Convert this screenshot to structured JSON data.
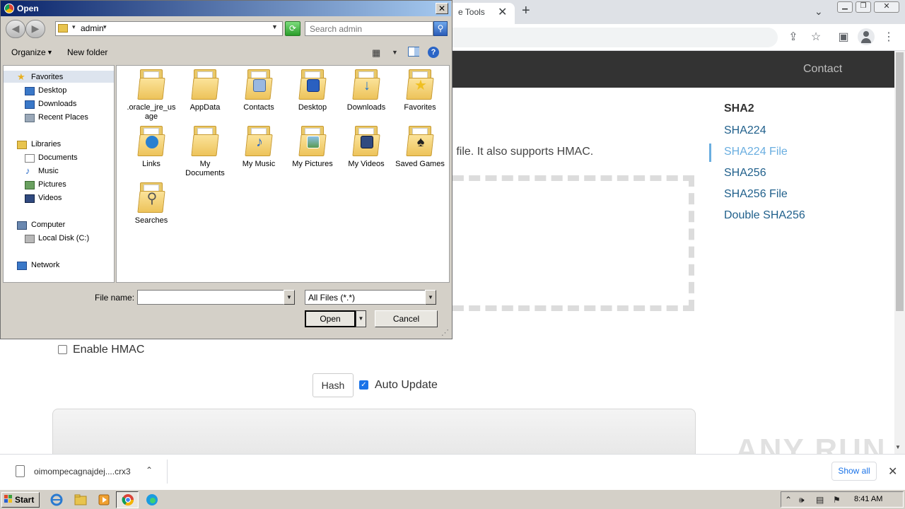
{
  "browser": {
    "tab_title": "e Tools",
    "tab_close": "✕",
    "new_tab": "+",
    "tab_search": "⌄"
  },
  "site": {
    "nav_contact": "Contact",
    "sidebar_heading": "SHA2",
    "sidebar_links": [
      "SHA224",
      "SHA224 File",
      "SHA256",
      "SHA256 File",
      "Double SHA256"
    ],
    "sidebar_active": "SHA224 File",
    "description": "g file. It also supports HMAC.",
    "hmac_label": "Enable HMAC",
    "hmac_checked": false,
    "hash_button": "Hash",
    "auto_update_label": "Auto Update",
    "auto_update_checked": true
  },
  "watermark": "ANY RUN",
  "downloads": {
    "file_name": "oimompecagnajdej....crx3",
    "chevron": "⌃",
    "show_all": "Show all",
    "close": "✕"
  },
  "taskbar": {
    "start_label": "Start",
    "clock": "8:41 AM"
  },
  "dialog": {
    "title": "Open",
    "close": "✕",
    "address": "admin",
    "search_placeholder": "Search admin",
    "organize": "Organize",
    "new_folder": "New folder",
    "nav": {
      "favorites": "Favorites",
      "favorites_items": [
        "Desktop",
        "Downloads",
        "Recent Places"
      ],
      "libraries": "Libraries",
      "libraries_items": [
        "Documents",
        "Music",
        "Pictures",
        "Videos"
      ],
      "computer": "Computer",
      "computer_items": [
        "Local Disk (C:)"
      ],
      "network": "Network"
    },
    "files": [
      {
        "label": ".oracle_jre_usage",
        "icon": "folder-icon"
      },
      {
        "label": "AppData",
        "icon": "folder-icon"
      },
      {
        "label": "Contacts",
        "icon": "contacts-folder-icon"
      },
      {
        "label": "Desktop",
        "icon": "desktop-folder-icon"
      },
      {
        "label": "Downloads",
        "icon": "downloads-folder-icon"
      },
      {
        "label": "Favorites",
        "icon": "favorites-folder-icon"
      },
      {
        "label": "Links",
        "icon": "links-folder-icon"
      },
      {
        "label": "My Documents",
        "icon": "documents-folder-icon"
      },
      {
        "label": "My Music",
        "icon": "music-folder-icon"
      },
      {
        "label": "My Pictures",
        "icon": "pictures-folder-icon"
      },
      {
        "label": "My Videos",
        "icon": "videos-folder-icon"
      },
      {
        "label": "Saved Games",
        "icon": "games-folder-icon"
      },
      {
        "label": "Searches",
        "icon": "searches-folder-icon"
      }
    ],
    "file_name_label": "File name:",
    "file_name_value": "",
    "filter_value": "All Files (*.*)",
    "open_button": "Open",
    "cancel_button": "Cancel"
  },
  "colors": {
    "nav_bg": "#333333",
    "link": "#1f5f8b",
    "link_active": "#6aaee0",
    "titlebar_start": "#0a246a",
    "titlebar_end": "#a6caf0"
  }
}
